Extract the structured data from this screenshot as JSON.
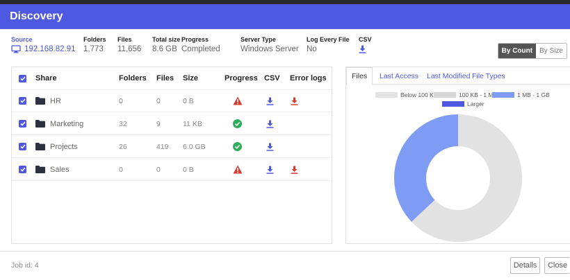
{
  "dialog": {
    "title": "Discovery"
  },
  "summary": {
    "source": {
      "label": "Source",
      "value": "192.168.82.91"
    },
    "folders": {
      "label": "Folders",
      "value": "1,773"
    },
    "files": {
      "label": "Files",
      "value": "11,656"
    },
    "total_size": {
      "label": "Total size",
      "value": "8.6 GB"
    },
    "progress": {
      "label": "Progress",
      "value": "Completed"
    },
    "server_type": {
      "label": "Server Type",
      "value": "Windows Server"
    },
    "log_every_file": {
      "label": "Log Every File",
      "value": "No"
    },
    "csv": {
      "label": "CSV"
    }
  },
  "view_toggle": {
    "by_count": "By Count",
    "by_size": "By Size",
    "selected": "By Count"
  },
  "table": {
    "headers": {
      "share": "Share",
      "folders": "Folders",
      "files": "Files",
      "size": "Size",
      "progress": "Progress",
      "csv": "CSV",
      "error_logs": "Error logs"
    },
    "rows": [
      {
        "name": "HR",
        "folders": "0",
        "files": "0",
        "size": "0 B",
        "status": "warning",
        "has_error_log": true
      },
      {
        "name": "Marketing",
        "folders": "32",
        "files": "9",
        "size": "11 KB",
        "status": "success",
        "has_error_log": false
      },
      {
        "name": "Projects",
        "folders": "26",
        "files": "419",
        "size": "6.0 GB",
        "status": "success",
        "has_error_log": false
      },
      {
        "name": "Sales",
        "folders": "0",
        "files": "0",
        "size": "0 B",
        "status": "warning",
        "has_error_log": true
      }
    ]
  },
  "tabs": [
    {
      "label": "Files",
      "active": true
    },
    {
      "label": "Last Access",
      "active": false
    },
    {
      "label": "Last Modified",
      "active": false
    },
    {
      "label": "File Types",
      "active": false
    }
  ],
  "chart_data": {
    "type": "pie",
    "donut": true,
    "categories": [
      "Below 100 KB",
      "100 KB - 1 MB",
      "1 MB - 1 GB",
      "Larger"
    ],
    "colors": [
      "#e2e2e2",
      "#d6d6d6",
      "#7f9cf5",
      "#4f58e0"
    ],
    "values": [
      63,
      0,
      37,
      0
    ],
    "legend_position": "top"
  },
  "footer": {
    "job_id": "Job id: 4",
    "details": "Details",
    "close": "Close"
  },
  "colors": {
    "accent": "#4f58e0",
    "warning": "#d63b2f",
    "success": "#2fae5b",
    "download": "#4f58e0",
    "error_download": "#d63b2f"
  },
  "icons": {
    "source": "monitor-icon",
    "folder": "folder-icon",
    "download": "download-icon",
    "warning": "warning-triangle-icon",
    "success": "check-circle-icon"
  }
}
